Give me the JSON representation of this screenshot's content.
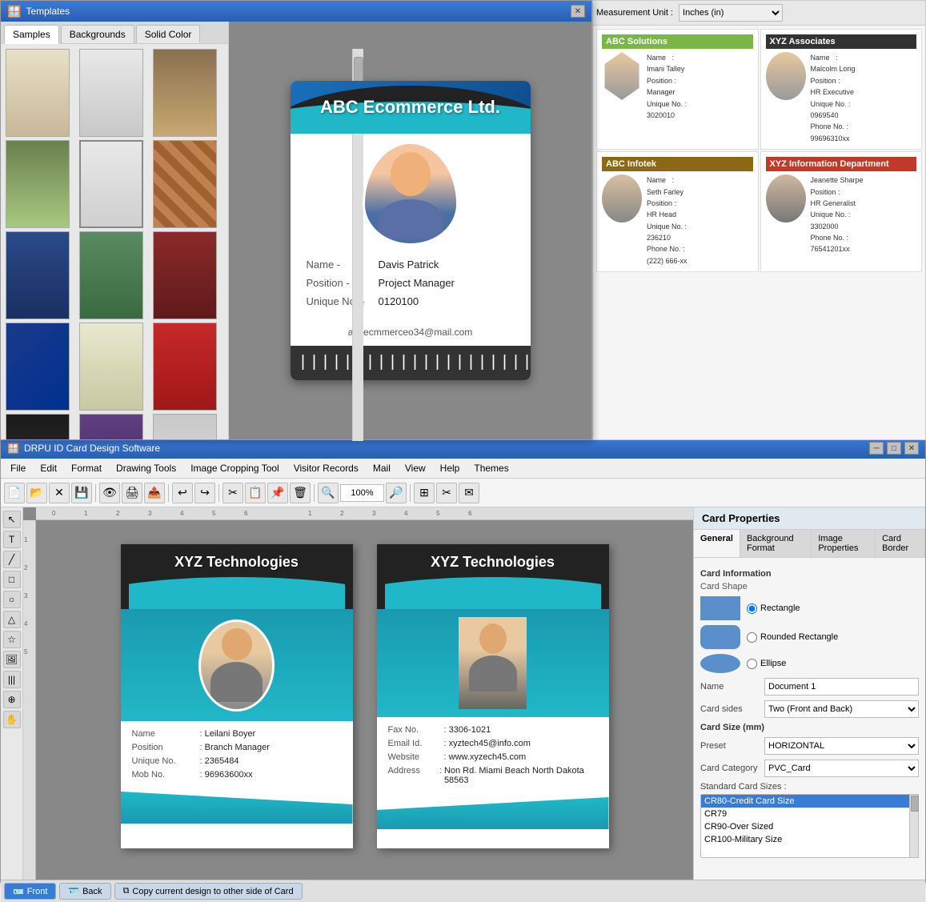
{
  "top_window": {
    "title": "Templates",
    "tabs": [
      "Samples",
      "Backgrounds",
      "Solid Color"
    ],
    "active_tab": "Samples",
    "id_card": {
      "company": "ABC Ecommerce Ltd.",
      "name_label": "Name -",
      "name_value": "Davis Patrick",
      "position_label": "Position -",
      "position_value": "Project Manager",
      "unique_label": "Unique No. -",
      "unique_value": "0120100",
      "email": "abcecmmerceo34@mail.com"
    }
  },
  "right_cards": {
    "abc_solutions": {
      "title": "ABC Solutions",
      "name": "Imani Talley",
      "position": "Manager",
      "unique": "3020010"
    },
    "xyz_associates": {
      "title": "XYZ Associates",
      "name": "Malcolm Long",
      "position": "HR Executive",
      "unique": "0969540",
      "phone": "99696310xx"
    },
    "abc_infotek": {
      "title": "ABC Infotek",
      "name": "Seth Farley",
      "position": "HR Head",
      "unique": "236210",
      "phone": "(222) 666-xx"
    },
    "xyz_info_dept": {
      "title": "XYZ Information Department",
      "name": "Jeanette Sharpe",
      "position": "HR Generalist",
      "unique": "3302000",
      "phone": "76541201xx"
    }
  },
  "bottom_window": {
    "title": "DRPU ID Card Design Software",
    "menus": [
      "File",
      "Edit",
      "Format",
      "Drawing Tools",
      "Image Cropping Tool",
      "Visitor Records",
      "Mail",
      "View",
      "Help",
      "Themes"
    ],
    "zoom": "100%",
    "canvas": {
      "front_card": {
        "company": "XYZ Technologies",
        "name_label": "Name",
        "name_value": "Leilani Boyer",
        "position_label": "Position",
        "position_value": "Branch Manager",
        "unique_label": "Unique No.",
        "unique_value": "2365484",
        "mob_label": "Mob No.",
        "mob_value": "96963600xx"
      },
      "back_card": {
        "company": "XYZ Technologies",
        "fax_label": "Fax No.",
        "fax_value": "3306-1021",
        "email_label": "Email Id.",
        "email_value": "xyztech45@info.com",
        "website_label": "Website",
        "website_value": "www.xyzech45.com",
        "address_label": "Address",
        "address_value": "Non Rd. Miami Beach North Dakota 58563"
      }
    },
    "bottom_tabs": [
      "Front",
      "Back",
      "Copy current design to other side of Card"
    ],
    "active_bottom_tab": "Front"
  },
  "card_properties": {
    "title": "Card Properties",
    "tabs": [
      "General",
      "Background Format",
      "Image Properties",
      "Card Border"
    ],
    "active_tab": "General",
    "section_card_info": "Card Information",
    "section_card_shape": "Card Shape",
    "shapes": [
      {
        "id": "rectangle",
        "label": "Rectangle",
        "selected": true
      },
      {
        "id": "rounded_rectangle",
        "label": "Rounded Rectangle",
        "selected": false
      },
      {
        "id": "ellipse",
        "label": "Ellipse",
        "selected": false
      }
    ],
    "name_label": "Name",
    "name_value": "Document 1",
    "card_sides_label": "Card sides",
    "card_sides_value": "Two (Front and Back)",
    "card_size_label": "Card Size (mm)",
    "preset_label": "Preset",
    "preset_value": "HORIZONTAL",
    "card_category_label": "Card Category",
    "card_category_value": "PVC_Card",
    "std_sizes_label": "Standard Card Sizes :",
    "sizes": [
      {
        "value": "CR80-Credit Card Size",
        "selected": true
      },
      {
        "value": "CR79",
        "selected": false
      },
      {
        "value": "CR90-Over Sized",
        "selected": false
      },
      {
        "value": "CR100-Military Size",
        "selected": false
      }
    ],
    "measurement_unit_label": "Measurement Unit :",
    "measurement_unit_value": "Inches (in)"
  }
}
